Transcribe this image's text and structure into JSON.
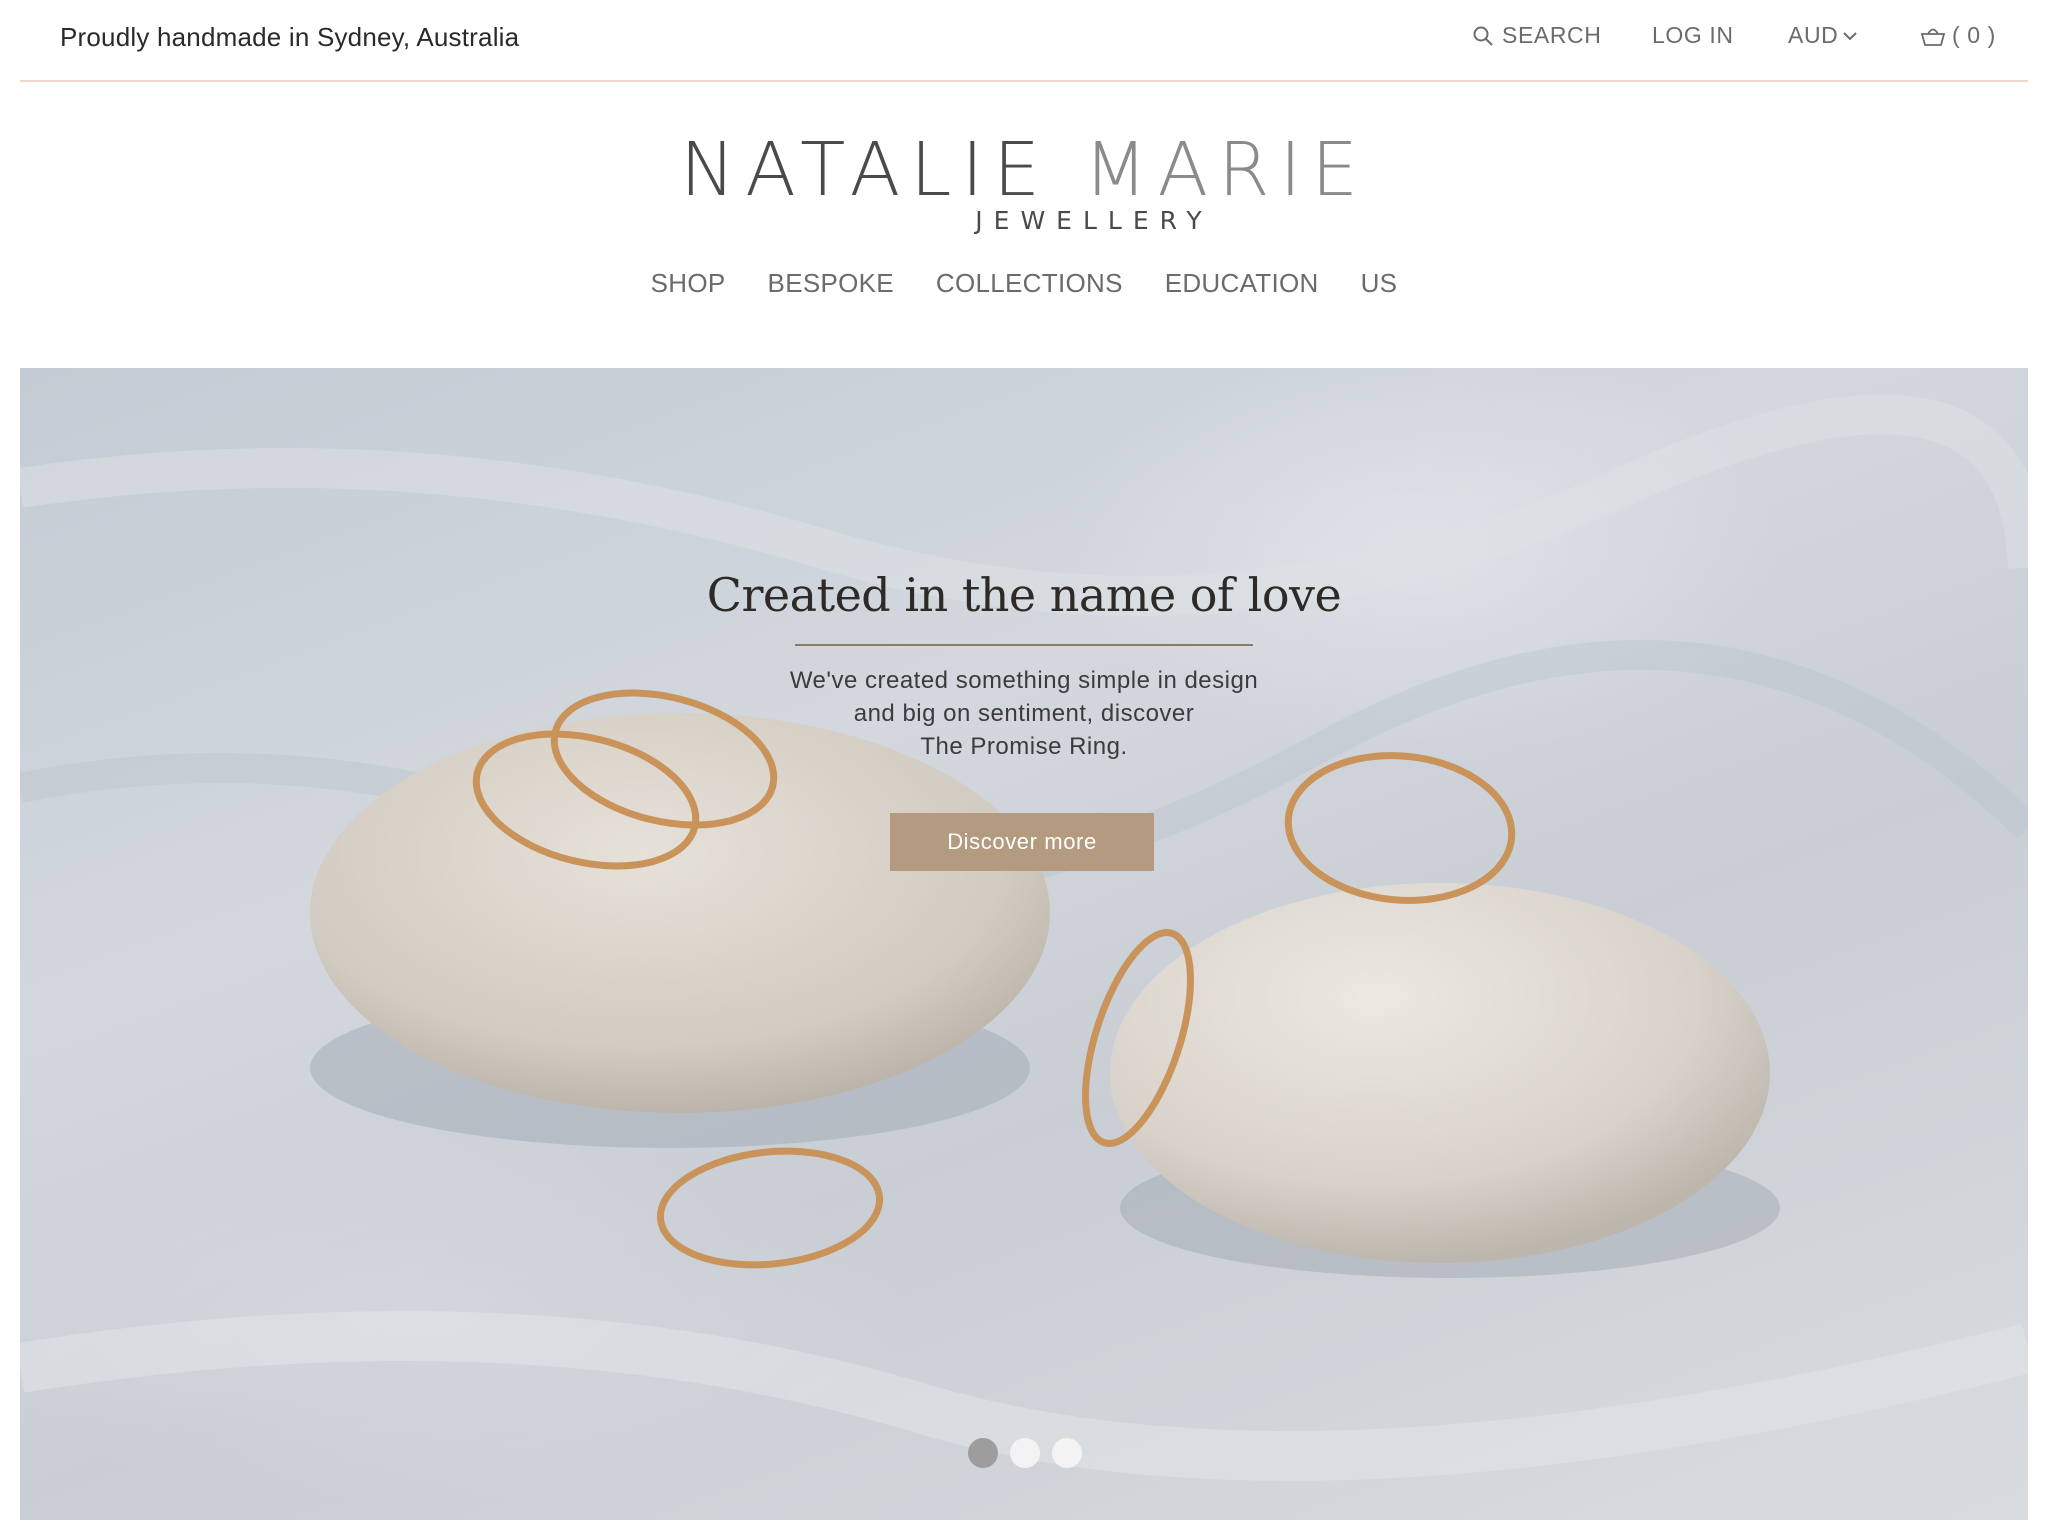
{
  "topbar": {
    "tagline": "Proudly handmade in Sydney, Australia",
    "search_label": "SEARCH",
    "login_label": "LOG IN",
    "currency_label": "AUD",
    "cart_label": "( 0 )"
  },
  "logo": {
    "name_first": "NATALIE",
    "name_second": "MARIE",
    "subtitle": "JEWELLERY"
  },
  "nav": {
    "items": [
      "SHOP",
      "BESPOKE",
      "COLLECTIONS",
      "EDUCATION",
      "US"
    ]
  },
  "hero": {
    "title": "Created in the name of love",
    "subtitle_line1": "We've created something simple in design",
    "subtitle_line2": "and big on sentiment, discover",
    "subtitle_line3": "The Promise Ring.",
    "button_label": "Discover more",
    "slide_count": 3,
    "active_slide": 1
  },
  "colors": {
    "accent_button": "#b49a7f",
    "divider_pink": "#f1d6cf",
    "text_dark": "#2a2a2a",
    "text_muted": "#6b6b6b"
  }
}
